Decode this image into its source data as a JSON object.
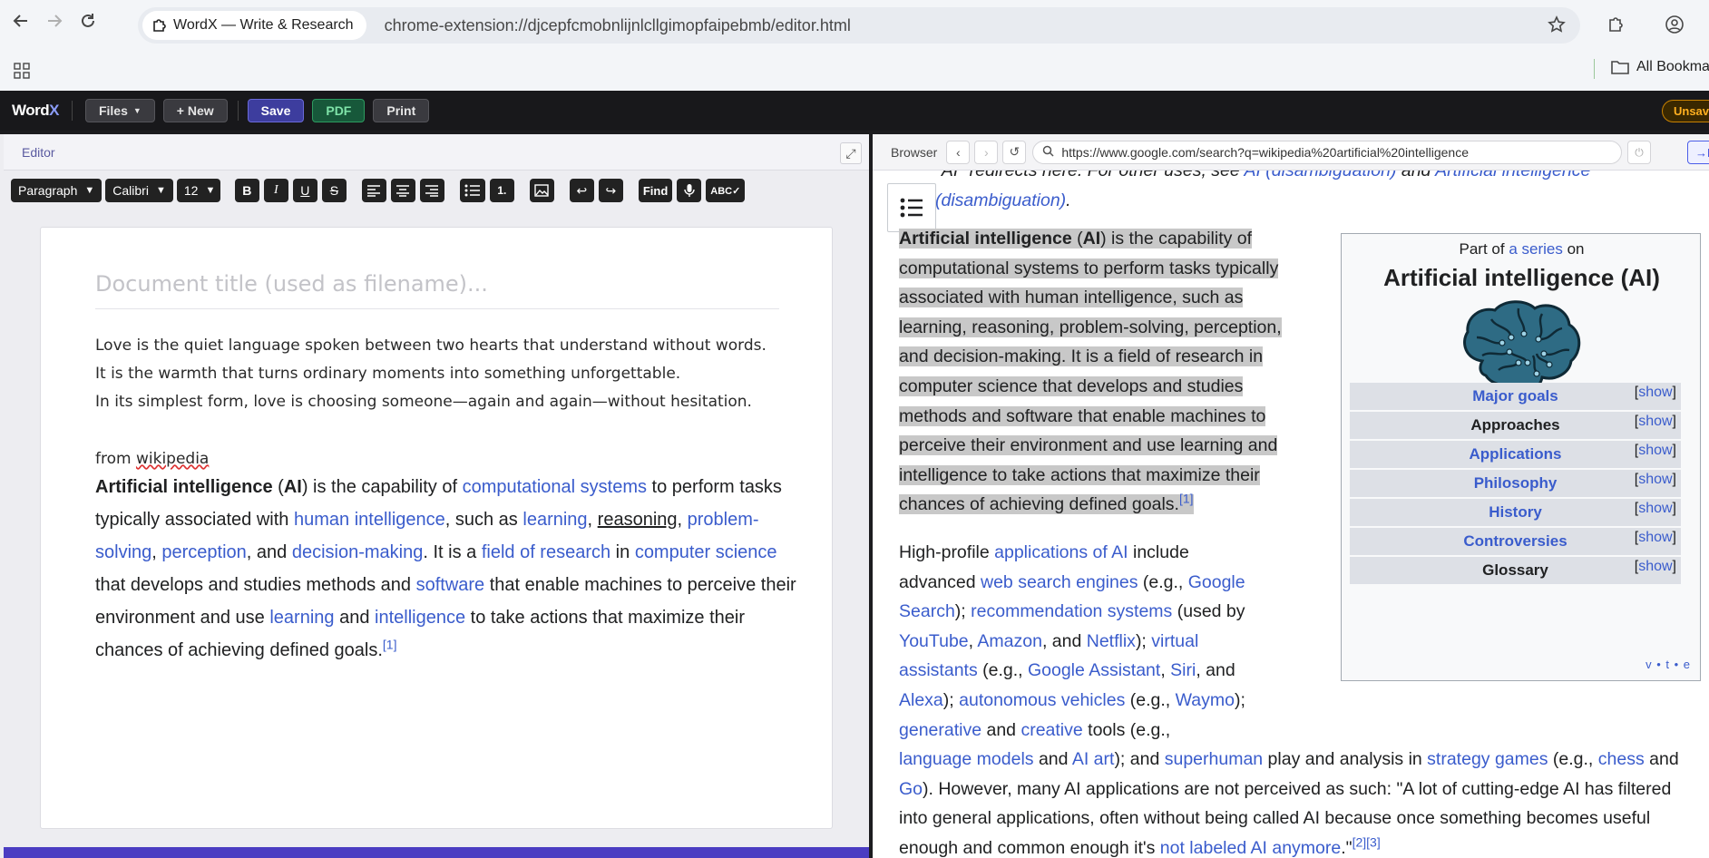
{
  "browser": {
    "tab_title": "WordX — Write & Research",
    "url": "chrome-extension://djcepfcmobnlijnlcllgimopfaipebmb/editor.html",
    "bookmarks_label": "All Bookma"
  },
  "app": {
    "logo_main": "Word",
    "logo_accent": "X",
    "files_label": "Files",
    "new_label": "+ New",
    "save_label": "Save",
    "pdf_label": "PDF",
    "print_label": "Print",
    "unsaved_label": "Unsave"
  },
  "editor": {
    "pane_label": "Editor",
    "toolbar": {
      "block_format": "Paragraph",
      "font": "Calibri",
      "font_size": "12",
      "bold": "B",
      "italic": "I",
      "underline": "U",
      "strike": "S",
      "find": "Find",
      "spellcheck": "ABC✓",
      "ordered_list": "1."
    },
    "title_placeholder": "Document title (used as filename)...",
    "lines": [
      "Love is the quiet language spoken between two hearts that understand without words.",
      "It is the warmth that turns ordinary moments into something unforgettable.",
      "In its simplest form, love is choosing someone—again and again—without hesitation."
    ],
    "from_label_a": "from ",
    "from_label_b": "wikipedia",
    "wiki": {
      "t1": "Artificial intelligence",
      "t2": " (",
      "t3": "AI",
      "t4": ") is the capability of ",
      "l1": "computational systems",
      "t5": " to perform tasks typically associated with ",
      "l2": "human intelligence",
      "t6": ", such as ",
      "l3": "learning",
      "t7": ", ",
      "u1": "reasoning",
      "t8": ", ",
      "l4": "problem-solving",
      "t9": ", ",
      "l5": "perception",
      "t10": ", and ",
      "l6": "decision-making",
      "t11": ". It is a ",
      "l7": "field of research",
      "t12": " in ",
      "l8": "computer science",
      "t13": " that develops and studies methods and ",
      "l9": "software",
      "t14": " that enable machines to perceive their environment and use ",
      "l10": "learning",
      "t15": " and ",
      "l11": "intelligence",
      "t16": " to take actions that maximize their chances of achieving defined goals.",
      "ref": "[1]"
    }
  },
  "research": {
    "pane_label": "Browser",
    "url": "https://www.google.com/search?q=wikipedia%20artificial%20intelligence",
    "ed_button": "→Ed",
    "hatnote": {
      "t1": "\"AI\" redirects here. For other uses, see ",
      "l1": "AI (disambiguation)",
      "t2": " and ",
      "l2": "Artificial intelligence (disambiguation)",
      "t3": "."
    },
    "lead": {
      "b1": "Artificial intelligence",
      "t1": " (",
      "b2": "AI",
      "t2": ") is the capability of computational systems to perform tasks typically associated with human intelligence, such as learning, reasoning, problem-solving, perception, and decision-making. It is a field of research in computer science that develops and studies methods and software that enable machines to perceive their environment and use learning and intelligence to take actions that maximize their chances of achieving defined goals.",
      "ref": "[1]"
    },
    "para2": {
      "t1": "High-profile ",
      "l1": "applications of AI",
      "t2": " include advanced ",
      "l2": "web search engines",
      "t3": " (e.g., ",
      "l3": "Google Search",
      "t4": "); ",
      "l4": "recommendation systems",
      "t5": " (used by ",
      "l5": "YouTube",
      "t6": ", ",
      "l6": "Amazon",
      "t7": ", and ",
      "l7": "Netflix",
      "t8": "); ",
      "l8": "virtual assistants",
      "t9": " (e.g., ",
      "l9": "Google Assistant",
      "t10": ", ",
      "l10": "Siri",
      "t11": ", and ",
      "l11": "Alexa",
      "t12": "); ",
      "l12": "autonomous vehicles",
      "t13": " (e.g., ",
      "l13": "Waymo",
      "t14": "); ",
      "l14": "generative",
      "t15": " and ",
      "l15": "creative",
      "t16": " tools (e.g., ",
      "l16": "language models",
      "t17": " and ",
      "l17": "AI art",
      "t18": "); and ",
      "l18": "superhuman",
      "t19": " play and analysis in ",
      "l19": "strategy games",
      "t20": " (e.g., ",
      "l20": "chess",
      "t21": " and ",
      "l21": "Go",
      "t22": "). However, many AI applications are not perceived as such: \"A lot of cutting-edge AI has filtered into general applications, often without being called AI because once something becomes useful enough and common enough it's ",
      "l22": "not labeled AI anymore",
      "t23": ".\"",
      "ref": "[2][3]"
    },
    "infobox": {
      "pre_a": "Part of ",
      "pre_link": "a series",
      "pre_b": " on",
      "title": "Artificial intelligence (AI)",
      "rows": [
        {
          "label": "Major goals",
          "link": true
        },
        {
          "label": "Approaches",
          "link": false
        },
        {
          "label": "Applications",
          "link": true
        },
        {
          "label": "Philosophy",
          "link": true
        },
        {
          "label": "History",
          "link": true
        },
        {
          "label": "Controversies",
          "link": true
        },
        {
          "label": "Glossary",
          "link": false
        }
      ],
      "show_open": "[",
      "show_label": "show",
      "show_close": "]",
      "vte": "v • t • e"
    }
  },
  "colors": {
    "link": "#3a5ccc",
    "highlight": "#c8c8c8",
    "accent": "#4b3dc2"
  }
}
